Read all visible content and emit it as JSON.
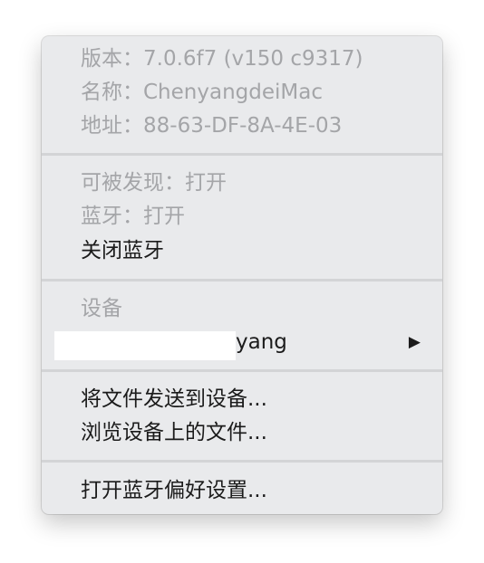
{
  "info": {
    "version": "版本：7.0.6f7 (v150 c9317)",
    "name": "名称：ChenyangdeiMac",
    "address": "地址：88-63-DF-8A-4E-03"
  },
  "status": {
    "discoverable": "可被发现：打开",
    "bluetooth": "蓝牙：打开",
    "turn_off": "关闭蓝牙"
  },
  "devices": {
    "header": "设备",
    "items": [
      {
        "name_visible": "yang",
        "submenu_glyph": "▶"
      }
    ]
  },
  "actions": {
    "send_file": "将文件发送到设备...",
    "browse_files": "浏览设备上的文件..."
  },
  "prefs": {
    "open_prefs": "打开蓝牙偏好设置..."
  }
}
